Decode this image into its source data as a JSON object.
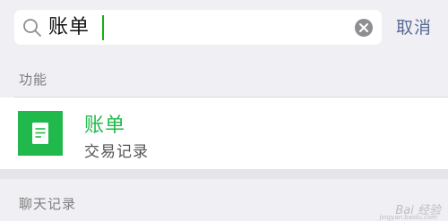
{
  "search": {
    "query": "账单",
    "cancel_label": "取消",
    "icons": {
      "search": "search-icon",
      "clear": "clear-icon"
    },
    "accent_color": "#1aad19"
  },
  "sections": {
    "features_title": "功能",
    "chat_history_title": "聊天记录"
  },
  "results": [
    {
      "title": "账单",
      "subtitle": "交易记录",
      "icon": "document-icon",
      "icon_color": "#21b94b"
    }
  ],
  "watermark": {
    "main": "Bai 经验",
    "sub": "jingyan.baidu.com"
  },
  "colors": {
    "link": "#576b95",
    "background": "#efeff4"
  }
}
